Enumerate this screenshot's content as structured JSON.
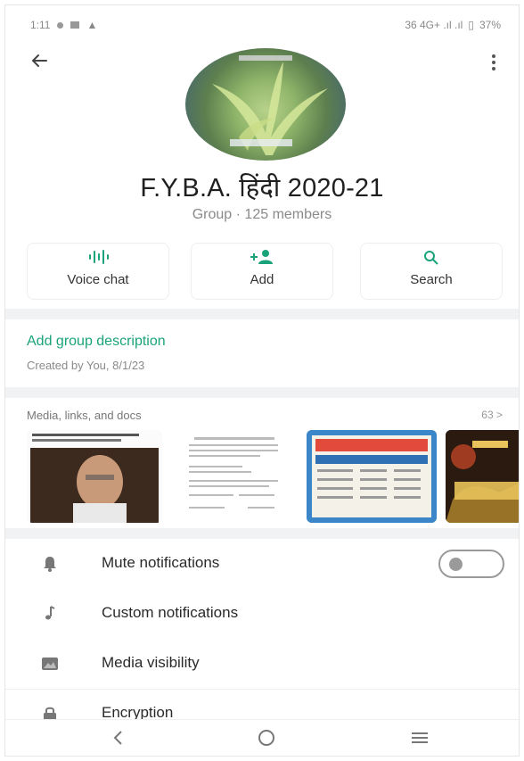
{
  "status_bar": {
    "time": "1:11",
    "right_text": "36 4G+ .ıl .ıl",
    "battery": "37%"
  },
  "group": {
    "name": "F.Y.B.A. हिंदी 2020-21",
    "subtitle": "Group · 125 members"
  },
  "actions": [
    {
      "label": "Voice chat",
      "icon": "voice-chat-icon"
    },
    {
      "label": "Add",
      "icon": "add-person-icon"
    },
    {
      "label": "Search",
      "icon": "search-icon"
    }
  ],
  "description": {
    "link": "Add group description",
    "created": "Created by You, 8/1/23"
  },
  "media": {
    "title": "Media, links, and docs",
    "count": "63 >"
  },
  "settings": [
    {
      "label": "Mute notifications",
      "icon": "bell-icon"
    },
    {
      "label": "Custom notifications",
      "icon": "music-note-icon"
    },
    {
      "label": "Media visibility",
      "icon": "image-icon"
    },
    {
      "label": "Encryption",
      "icon": "lock-icon"
    }
  ],
  "toggle": {
    "mute_on": false
  },
  "colors": {
    "accent": "#1aa37a",
    "muted": "#8a8a8a",
    "band": "#f1f2f3"
  },
  "nav": [
    "back-nav-icon",
    "home-nav-icon",
    "recents-nav-icon"
  ]
}
